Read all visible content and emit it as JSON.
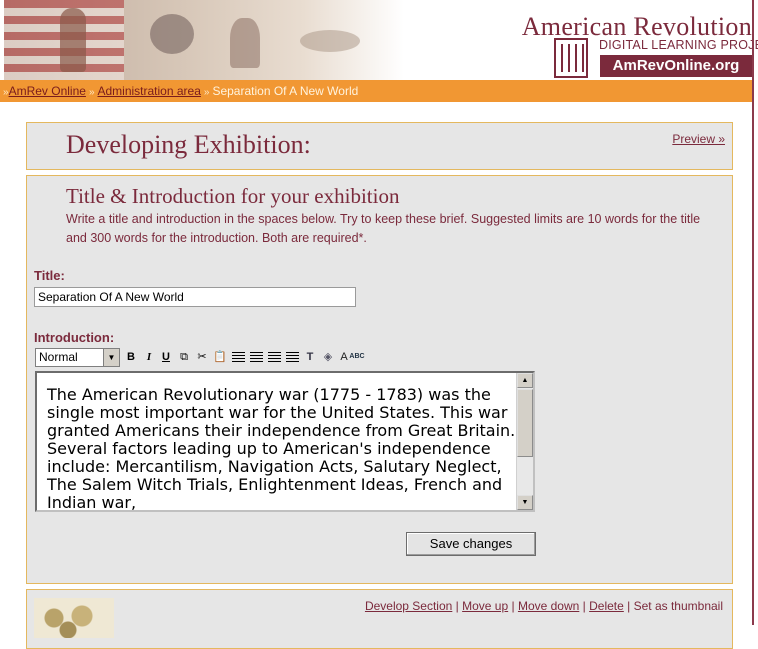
{
  "header": {
    "logo_title": "American Revolution",
    "logo_subtitle": "DIGITAL LEARNING PROJECT",
    "logo_site": "AmRevOnline.org",
    "brand_color": "#7b2a3c"
  },
  "breadcrumb": {
    "items": [
      "AmRev Online",
      "Administration area"
    ],
    "current": "Separation Of A New World",
    "separator": "»"
  },
  "main": {
    "page_title": "Developing Exhibition:",
    "preview_link": "Preview »",
    "section": {
      "heading": "Title & Introduction for your exhibition",
      "instructions": "Write a title and introduction in the spaces below. Try to keep these brief. Suggested limits are 10 words for the title and 300 words for the introduction. Both are required*.",
      "title_label": "Title:",
      "title_value": "Separation Of A New World",
      "intro_label": "Introduction:",
      "format_select": "Normal",
      "toolbar": {
        "bold": "B",
        "italic": "I",
        "underline": "U",
        "icons": [
          "copy-icon",
          "cut-icon",
          "paste-icon",
          "align-left-icon",
          "align-center-icon",
          "align-right-icon",
          "justify-icon",
          "text-color-icon",
          "fill-color-icon",
          "spellcheck-icon"
        ],
        "spell_label": "ABC"
      },
      "intro_text": "The American Revolutionary war (1775 - 1783) was the single most important war for the United States. This war granted Americans their independence from Great Britain. Several factors leading up to American's independence include: Mercantilism, Navigation Acts, Salutary Neglect, The Salem Witch Trials, Enlightenment Ideas, French and Indian war,",
      "save_label": "Save changes"
    },
    "next_section": {
      "actions": [
        "Develop Section",
        "Move up",
        "Move down",
        "Delete"
      ],
      "thumbnail_action": "Set as thumbnail"
    }
  },
  "colors": {
    "accent_orange": "#f19733",
    "panel_bg": "#e6e6e6",
    "panel_border": "#e4b85e"
  }
}
